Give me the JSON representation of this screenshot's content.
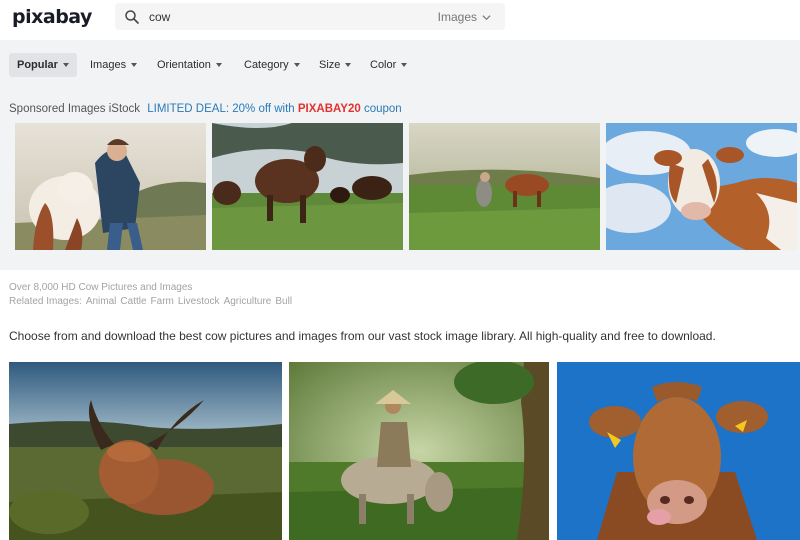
{
  "header": {
    "logo": "pixabay",
    "search": {
      "value": "cow",
      "placeholder": ""
    },
    "search_type": "Images"
  },
  "filters": [
    {
      "label": "Popular",
      "active": true
    },
    {
      "label": "Images",
      "active": false
    },
    {
      "label": "Orientation",
      "active": false
    },
    {
      "label": "Category",
      "active": false
    },
    {
      "label": "Size",
      "active": false
    },
    {
      "label": "Color",
      "active": false
    }
  ],
  "sponsored": {
    "label": "Sponsored Images iStock",
    "deal_text": "LIMITED DEAL: 20% off with",
    "code": "PIXABAY20",
    "code_suffix": "coupon",
    "images": [
      {
        "alt": "woman hugging calf"
      },
      {
        "alt": "brown cows in field"
      },
      {
        "alt": "farmer with cow in pasture"
      },
      {
        "alt": "brown and white cow against sky"
      }
    ]
  },
  "info": {
    "count_text": "Over 8,000 HD Cow Pictures and Images",
    "related_label": "Related Images:",
    "related": [
      "Animal",
      "Cattle",
      "Farm",
      "Livestock",
      "Agriculture",
      "Bull"
    ]
  },
  "description": "Choose from and download the best cow pictures and images from our vast stock image library. All high-quality and free to download.",
  "results": [
    {
      "alt": "highland cattle lying in field"
    },
    {
      "alt": "man with hat riding on buffalo"
    },
    {
      "alt": "brown cow licking nose"
    }
  ],
  "colors": {
    "accent_link": "#2a7ab8",
    "coupon": "#e3322e",
    "filterbar_bg": "#f2f3f5"
  }
}
